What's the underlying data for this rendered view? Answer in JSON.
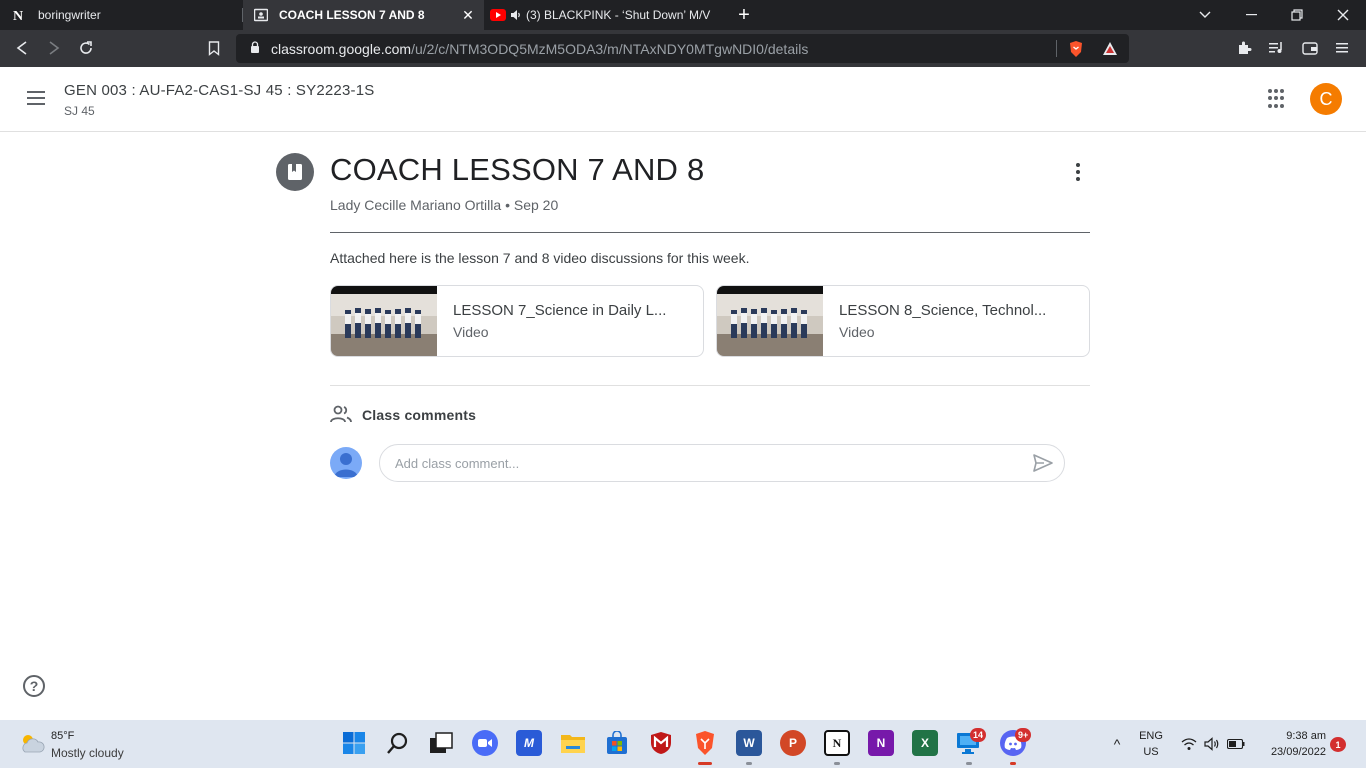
{
  "browser": {
    "tabs": [
      {
        "label": "boringwriter",
        "favicon": "notion-icon"
      },
      {
        "label": "COACH LESSON 7 AND 8",
        "favicon": "classroom-icon",
        "active": true
      },
      {
        "label": "(3) BLACKPINK - ‘Shut Down’ M/V",
        "favicon": "youtube-icon",
        "audio": true
      }
    ],
    "close_glyph": "✕",
    "new_tab_glyph": "+",
    "url_host": "classroom.google.com",
    "url_path": "/u/2/c/NTM3ODQ5MzM5ODA3/m/NTAxNDY0MTgwNDI0/details",
    "accent_brave": "#fb542b"
  },
  "classroom": {
    "course_title": "GEN 003 : AU-FA2-CAS1-SJ 45 : SY2223-1S",
    "course_section": "SJ 45",
    "account_initial": "C",
    "account_color": "#f57c00"
  },
  "post": {
    "title": "COACH LESSON 7 AND 8",
    "author": "Lady Cecille Mariano Ortilla",
    "separator": "•",
    "date": "Sep 20",
    "body": "Attached here is the lesson 7 and 8 video discussions for this week.",
    "attachments": [
      {
        "title": "LESSON 7_Science in Daily L...",
        "type": "Video"
      },
      {
        "title": "LESSON 8_Science, Technol...",
        "type": "Video"
      }
    ]
  },
  "comments": {
    "label": "Class comments",
    "placeholder": "Add class comment..."
  },
  "help_glyph": "?",
  "taskbar": {
    "weather_temp": "85°F",
    "weather_desc": "Mostly cloudy",
    "apps": [
      {
        "name": "start",
        "label": ""
      },
      {
        "name": "search",
        "label": ""
      },
      {
        "name": "task-view",
        "label": ""
      },
      {
        "name": "zoom",
        "label": ""
      },
      {
        "name": "vscode",
        "label": "M"
      },
      {
        "name": "file-explorer",
        "label": ""
      },
      {
        "name": "microsoft-store",
        "label": ""
      },
      {
        "name": "mcafee",
        "label": "M"
      },
      {
        "name": "brave",
        "label": ""
      },
      {
        "name": "word",
        "label": "W"
      },
      {
        "name": "powerpoint",
        "label": "P"
      },
      {
        "name": "notion",
        "label": "N"
      },
      {
        "name": "onenote",
        "label": "N"
      },
      {
        "name": "excel",
        "label": "X"
      },
      {
        "name": "remote",
        "label": ""
      },
      {
        "name": "discord",
        "label": ""
      }
    ],
    "remote_badge": "14",
    "discord_badge": "9+",
    "tray_chevron": "^",
    "lang": "ENG",
    "region": "US",
    "time": "9:38 am",
    "date": "23/09/2022",
    "notification_count": "1"
  }
}
